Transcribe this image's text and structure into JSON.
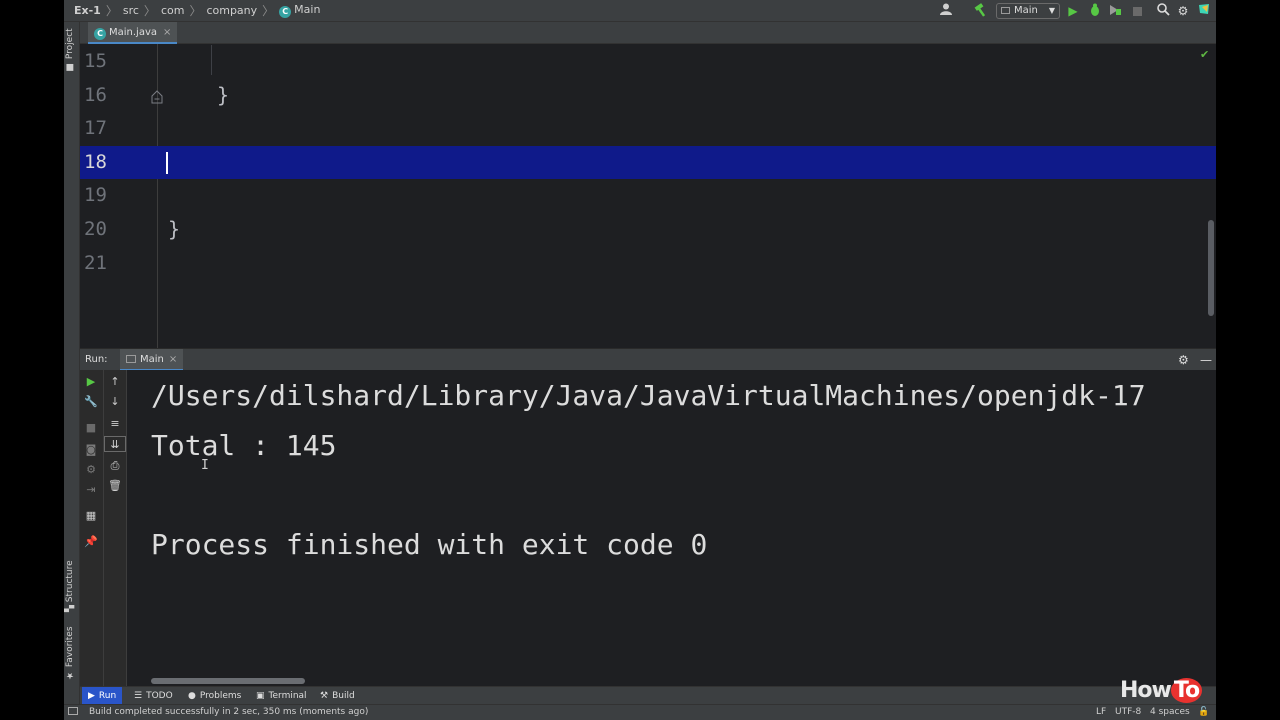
{
  "breadcrumb": {
    "project": "Ex-1",
    "folder1": "src",
    "folder2": "com",
    "folder3": "company",
    "class_badge": "C",
    "class": "Main"
  },
  "toolbar": {
    "run_config": "Main",
    "user_icon": "user-icon",
    "build_icon": "hammer-icon",
    "run_icon": "play-icon",
    "debug_icon": "bug-icon",
    "coverage_icon": "coverage-icon",
    "stop_icon": "stop-icon",
    "search_icon": "search-icon",
    "settings_icon": "gear-icon",
    "colors": {
      "run": "#57c845",
      "build": "#57c845"
    }
  },
  "left_strip": {
    "project": "Project",
    "structure": "Structure",
    "favorites": "Favorites"
  },
  "editor": {
    "tab": {
      "badge": "C",
      "label": "Main.java",
      "close": "×"
    },
    "lines": [
      {
        "number": "15",
        "code": ""
      },
      {
        "number": "16",
        "code": "}"
      },
      {
        "number": "17",
        "code": ""
      },
      {
        "number": "18",
        "code": ""
      },
      {
        "number": "19",
        "code": ""
      },
      {
        "number": "20",
        "code": "}"
      },
      {
        "number": "21",
        "code": ""
      }
    ],
    "current_line": "18",
    "current_line_color": "#0f1a8a",
    "inspection_status": "✔"
  },
  "run_window": {
    "label": "Run:",
    "tab": {
      "label": "Main",
      "close": "×"
    },
    "console": [
      "/Users/dilshard/Library/Java/JavaVirtualMachines/openjdk-17",
      "Total : 145",
      "",
      "Process finished with exit code 0"
    ]
  },
  "bottom_tools": {
    "run": "Run",
    "todo": "TODO",
    "problems": "Problems",
    "terminal": "Terminal",
    "build": "Build"
  },
  "status_bar": {
    "message": "Build completed successfully in 2 sec, 350 ms (moments ago)",
    "line_separator": "LF",
    "encoding": "UTF-8",
    "indent": "4 spaces"
  },
  "watermark": {
    "part1": "How",
    "part2": "To"
  }
}
